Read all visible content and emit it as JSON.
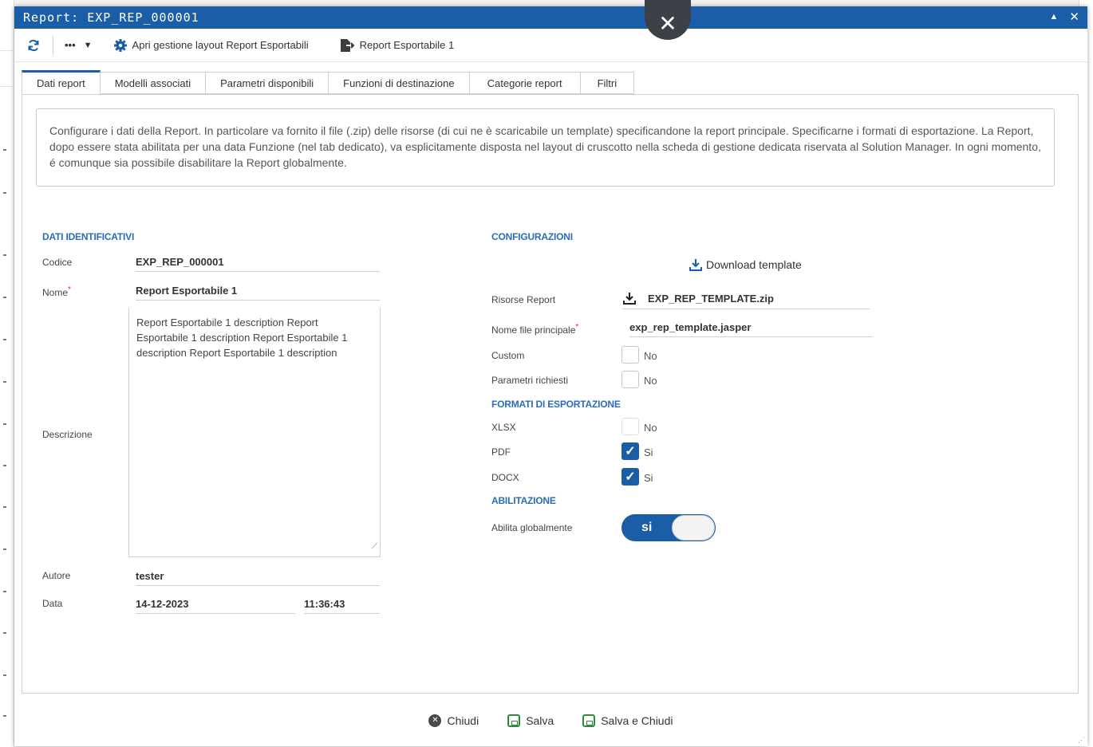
{
  "window": {
    "title": "Report: EXP_REP_000001",
    "minimize_glyph": "▲",
    "close_glyph": "✕"
  },
  "overlay_close_glyph": "✕",
  "toolbar": {
    "refresh_icon": "refresh-icon",
    "more_glyph": "•••",
    "dropdown_glyph": "▼",
    "manage_layout_label": "Apri gestione layout Report Esportabili",
    "export_report_label": "Report Esportabile 1"
  },
  "tabs": [
    {
      "label": "Dati report",
      "active": true
    },
    {
      "label": "Modelli associati"
    },
    {
      "label": "Parametri disponibili"
    },
    {
      "label": "Funzioni di destinazione"
    },
    {
      "label": "Categorie report"
    },
    {
      "label": "Filtri"
    }
  ],
  "info_text": "Configurare i dati della Report. In particolare va fornito il file (.zip) delle risorse (di cui ne è scaricabile un template) specificandone la report principale. Specificarne i formati di esportazione. La Report, dopo essere stata abilitata per una data Funzione (nel tab dedicato), va esplicitamente disposta nel layout di cruscotto nella scheda di gestione dedicata riservata al Solution Manager. In ogni momento, é comunque sia possibile disabilitare la Report globalmente.",
  "identificativi": {
    "section_title": "DATI IDENTIFICATIVI",
    "codice_label": "Codice",
    "codice_value": "EXP_REP_000001",
    "nome_label": "Nome",
    "required_mark": "*",
    "nome_value": "Report Esportabile 1",
    "descrizione_label": "Descrizione",
    "descrizione_value": "Report Esportabile 1 description Report Esportabile 1 description Report Esportabile 1 description Report Esportabile 1 description",
    "autore_label": "Autore",
    "autore_value": "tester",
    "data_label": "Data",
    "data_date": "14-12-2023",
    "data_time": "11:36:43"
  },
  "configurazioni": {
    "section_title": "CONFIGURAZIONI",
    "download_template_label": "Download template",
    "risorse_label": "Risorse Report",
    "risorse_value": "EXP_REP_TEMPLATE.zip",
    "nome_file_label": "Nome file principale",
    "nome_file_value": "exp_rep_template.jasper",
    "custom_label": "Custom",
    "custom_value": "No",
    "parametri_label": "Parametri richiesti",
    "parametri_value": "No"
  },
  "formati": {
    "section_title": "FORMATI DI ESPORTAZIONE",
    "xlsx_label": "XLSX",
    "xlsx_value": "No",
    "pdf_label": "PDF",
    "pdf_value": "Si",
    "docx_label": "DOCX",
    "docx_value": "Si",
    "check_glyph": "✓"
  },
  "abilitazione": {
    "section_title": "ABILITAZIONE",
    "label": "Abilita globalmente",
    "switch_text": "si"
  },
  "footer": {
    "chiudi_label": "Chiudi",
    "salva_label": "Salva",
    "salva_chiudi_label": "Salva e Chiudi"
  },
  "colors": {
    "primary": "#1a5ea8",
    "accent_text": "#2a6db5",
    "save_green": "#2e8b3e",
    "required_red": "#dd3333"
  }
}
